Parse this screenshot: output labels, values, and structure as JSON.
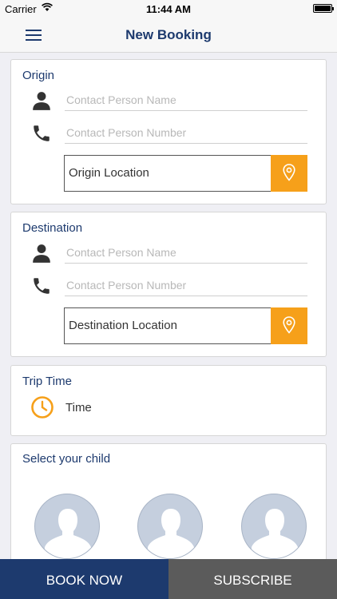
{
  "status_bar": {
    "carrier": "Carrier",
    "time": "11:44 AM",
    "wifi_icon": "wifi-icon",
    "battery_icon": "battery-icon"
  },
  "nav": {
    "title": "New Booking",
    "menu_icon": "hamburger-menu-icon"
  },
  "origin": {
    "title": "Origin",
    "name_placeholder": "Contact Person Name",
    "number_placeholder": "Contact Person Number",
    "location_label": "Origin Location"
  },
  "destination": {
    "title": "Destination",
    "name_placeholder": "Contact Person Name",
    "number_placeholder": "Contact Person Number",
    "location_label": "Destination Location"
  },
  "trip_time": {
    "title": "Trip Time",
    "time_label": "Time"
  },
  "child": {
    "title": "Select your child",
    "avatar_icon": "child-avatar-placeholder-icon"
  },
  "actions": {
    "book_now": "BOOK NOW",
    "subscribe": "SUBSCRIBE"
  },
  "colors": {
    "primary": "#1d3a6e",
    "accent": "#f6a01a",
    "secondary": "#5b5b5b"
  }
}
